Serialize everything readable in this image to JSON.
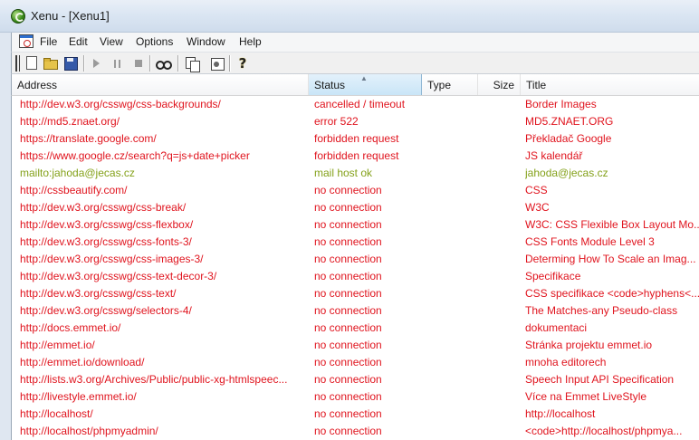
{
  "window": {
    "title": "Xenu - [Xenu1]"
  },
  "menu": [
    "File",
    "Edit",
    "View",
    "Options",
    "Window",
    "Help"
  ],
  "toolbar": [
    "new-icon",
    "open-icon",
    "save-icon",
    "play-icon",
    "pause-icon",
    "stop-icon",
    "find-icon",
    "copy-icon",
    "properties-icon",
    "help-icon"
  ],
  "columns": {
    "address": "Address",
    "status": "Status",
    "type": "Type",
    "size": "Size",
    "title": "Title"
  },
  "colors": {
    "error": "#e0141e",
    "ok": "#84a11a"
  },
  "rows": [
    {
      "address": "http://dev.w3.org/csswg/css-backgrounds/",
      "status": "cancelled / timeout",
      "title": "Border Images",
      "state": "error"
    },
    {
      "address": "http://md5.znaet.org/",
      "status": "error 522",
      "title": "MD5.ZNAET.ORG",
      "state": "error"
    },
    {
      "address": "https://translate.google.com/",
      "status": "forbidden request",
      "title": "Překladač Google",
      "state": "error"
    },
    {
      "address": "https://www.google.cz/search?q=js+date+picker",
      "status": "forbidden request",
      "title": "JS kalendář",
      "state": "error"
    },
    {
      "address": "mailto:jahoda@jecas.cz",
      "status": "mail host ok",
      "title": "jahoda@jecas.cz",
      "state": "ok"
    },
    {
      "address": "http://cssbeautify.com/",
      "status": "no connection",
      "title": "CSS",
      "state": "error"
    },
    {
      "address": "http://dev.w3.org/csswg/css-break/",
      "status": "no connection",
      "title": "W3C",
      "state": "error"
    },
    {
      "address": "http://dev.w3.org/csswg/css-flexbox/",
      "status": "no connection",
      "title": "W3C: CSS Flexible Box Layout Mo...",
      "state": "error"
    },
    {
      "address": "http://dev.w3.org/csswg/css-fonts-3/",
      "status": "no connection",
      "title": "CSS Fonts Module Level 3",
      "state": "error"
    },
    {
      "address": "http://dev.w3.org/csswg/css-images-3/",
      "status": "no connection",
      "title": "Determing How To Scale an Imag...",
      "state": "error"
    },
    {
      "address": "http://dev.w3.org/csswg/css-text-decor-3/",
      "status": "no connection",
      "title": "Specifikace",
      "state": "error"
    },
    {
      "address": "http://dev.w3.org/csswg/css-text/",
      "status": "no connection",
      "title": "CSS specifikace <code>hyphens<...",
      "state": "error"
    },
    {
      "address": "http://dev.w3.org/csswg/selectors-4/",
      "status": "no connection",
      "title": "The Matches-any Pseudo-class",
      "state": "error"
    },
    {
      "address": "http://docs.emmet.io/",
      "status": "no connection",
      "title": "dokumentaci",
      "state": "error"
    },
    {
      "address": "http://emmet.io/",
      "status": "no connection",
      "title": "Stránka projektu emmet.io",
      "state": "error"
    },
    {
      "address": "http://emmet.io/download/",
      "status": "no connection",
      "title": "mnoha editorech",
      "state": "error"
    },
    {
      "address": "http://lists.w3.org/Archives/Public/public-xg-htmlspeec...",
      "status": "no connection",
      "title": "Speech Input API Specification",
      "state": "error"
    },
    {
      "address": "http://livestyle.emmet.io/",
      "status": "no connection",
      "title": "Více na Emmet LiveStyle",
      "state": "error"
    },
    {
      "address": "http://localhost/",
      "status": "no connection",
      "title": "http://localhost",
      "state": "error"
    },
    {
      "address": "http://localhost/phpmyadmin/",
      "status": "no connection",
      "title": "<code>http://localhost/phpmya...",
      "state": "error"
    }
  ]
}
